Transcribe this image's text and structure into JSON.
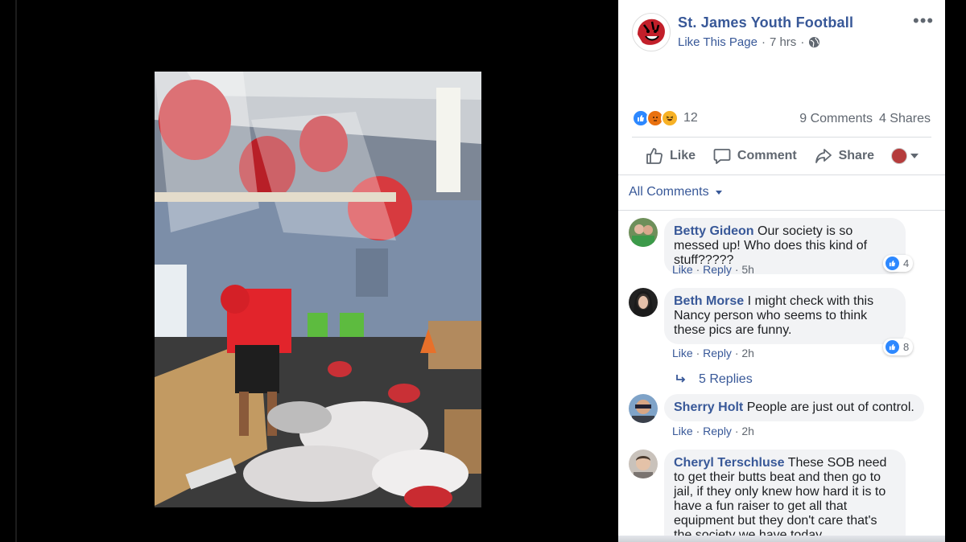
{
  "post": {
    "page_name": "St. James Youth Football",
    "like_page": "Like This Page",
    "time": "7 hrs",
    "reaction_count": "12",
    "comments_count": "9 Comments",
    "shares_count": "4 Shares",
    "reactions": [
      "like",
      "angry",
      "haha"
    ]
  },
  "actions": {
    "like": "Like",
    "comment": "Comment",
    "share": "Share"
  },
  "filter": {
    "label": "All Comments"
  },
  "comments": [
    {
      "author": "Betty Gideon",
      "text": "Our society is so messed up! Who does this kind of stuff?????",
      "like": "Like",
      "reply": "Reply",
      "time": "5h",
      "reactions": "4"
    },
    {
      "author": "Beth Morse",
      "text": "I might check with this Nancy person who seems to think these pics are funny.",
      "like": "Like",
      "reply": "Reply",
      "time": "2h",
      "reactions": "8"
    },
    {
      "author": "Sherry Holt",
      "text": "People are just out of control.",
      "like": "Like",
      "reply": "Reply",
      "time": "2h"
    },
    {
      "author": "Cheryl Terschluse",
      "text": "These SOB need to get their butts beat and then go to jail, if they only knew how hard it is to have a fun raiser to get all that equipment but they don't care that's the society we have today"
    }
  ],
  "replies": {
    "label": "5 Replies"
  },
  "colors": {
    "link": "#385898",
    "meta": "#606770",
    "bubble": "#f2f3f5",
    "like_blue": "#2d88ff"
  }
}
